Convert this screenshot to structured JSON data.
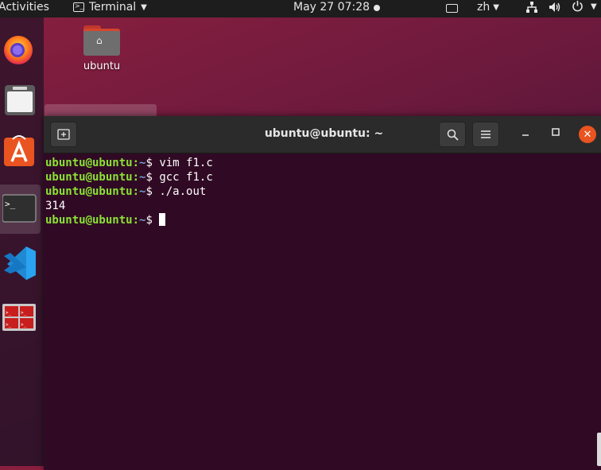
{
  "topbar": {
    "activities": "Activities",
    "app_name": "Terminal",
    "clock": "May 27  07:28",
    "language": "zh"
  },
  "desktop": {
    "folder_label": "ubuntu"
  },
  "dock": {
    "items": [
      "firefox-icon",
      "files-icon",
      "software-icon",
      "terminal-icon",
      "vscode-icon",
      "multi-terminal-icon"
    ]
  },
  "terminal": {
    "title": "ubuntu@ubuntu: ~",
    "lines": [
      {
        "user": "ubuntu@ubuntu",
        "sep": ":",
        "path": "~",
        "prompt": "$ ",
        "cmd": "vim f1.c"
      },
      {
        "user": "ubuntu@ubuntu",
        "sep": ":",
        "path": "~",
        "prompt": "$ ",
        "cmd": "gcc f1.c"
      },
      {
        "user": "ubuntu@ubuntu",
        "sep": ":",
        "path": "~",
        "prompt": "$ ",
        "cmd": "./a.out"
      },
      {
        "output": "314"
      },
      {
        "user": "ubuntu@ubuntu",
        "sep": ":",
        "path": "~",
        "prompt": "$ ",
        "cmd": ""
      }
    ]
  },
  "colors": {
    "terminal_bg": "#300a24",
    "prompt_user": "#8ae234",
    "prompt_path": "#729fcf",
    "close_button": "#e95420"
  }
}
